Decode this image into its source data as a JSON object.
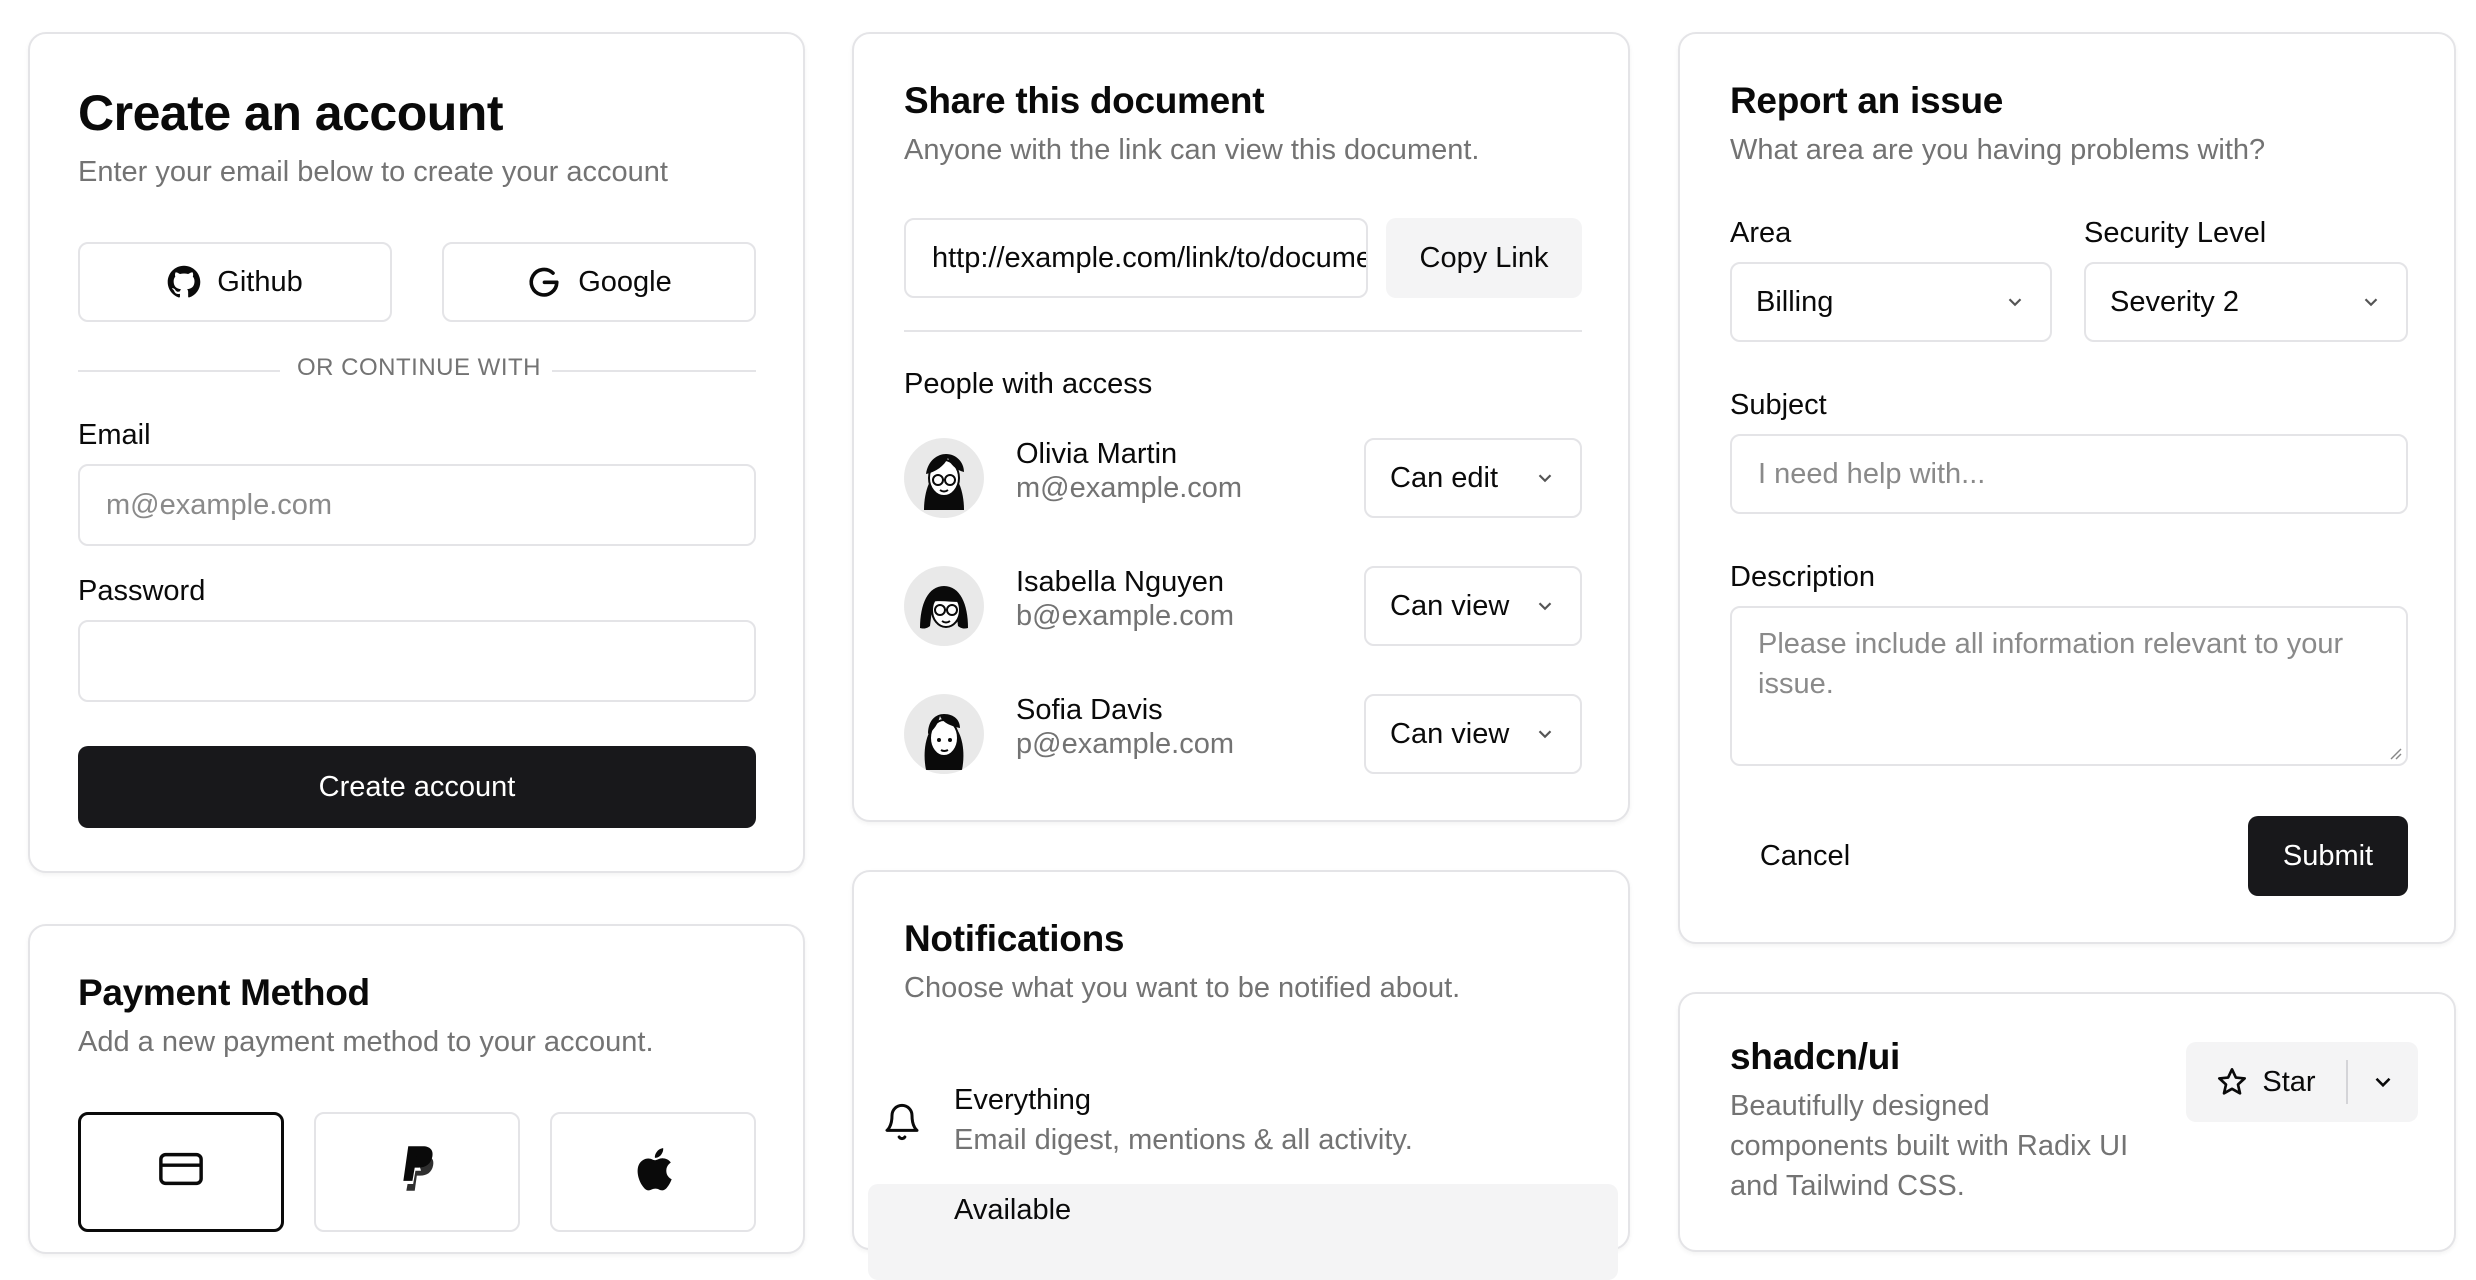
{
  "account": {
    "title": "Create an account",
    "subtitle": "Enter your email below to create your account",
    "github_label": "Github",
    "google_label": "Google",
    "divider": "OR CONTINUE WITH",
    "email_label": "Email",
    "email_placeholder": "m@example.com",
    "password_label": "Password",
    "password_value": "",
    "submit_label": "Create account"
  },
  "payment": {
    "title": "Payment Method",
    "subtitle": "Add a new payment method to your account.",
    "methods": [
      {
        "icon": "credit-card-icon",
        "selected": true
      },
      {
        "icon": "paypal-icon",
        "selected": false
      },
      {
        "icon": "apple-icon",
        "selected": false
      }
    ]
  },
  "share": {
    "title": "Share this document",
    "subtitle": "Anyone with the link can view this document.",
    "link_value": "http://example.com/link/to/document",
    "copy_label": "Copy Link",
    "people_heading": "People with access",
    "people": [
      {
        "name": "Olivia Martin",
        "email": "m@example.com",
        "permission": "Can edit"
      },
      {
        "name": "Isabella Nguyen",
        "email": "b@example.com",
        "permission": "Can view"
      },
      {
        "name": "Sofia Davis",
        "email": "p@example.com",
        "permission": "Can view"
      }
    ]
  },
  "notifications": {
    "title": "Notifications",
    "subtitle": "Choose what you want to be notified about.",
    "items": [
      {
        "title": "Everything",
        "description": "Email digest, mentions & all activity."
      },
      {
        "title": "Available",
        "description": ""
      }
    ]
  },
  "report": {
    "title": "Report an issue",
    "subtitle": "What area are you having problems with?",
    "area_label": "Area",
    "area_value": "Billing",
    "security_label": "Security Level",
    "security_value": "Severity 2",
    "subject_label": "Subject",
    "subject_placeholder": "I need help with...",
    "description_label": "Description",
    "description_placeholder": "Please include all information relevant to your issue.",
    "cancel_label": "Cancel",
    "submit_label": "Submit"
  },
  "repo": {
    "name": "shadcn/ui",
    "description_lines": [
      "Beautifully designed",
      "components built with Radix UI",
      "and Tailwind CSS."
    ],
    "star_label": "Star"
  }
}
